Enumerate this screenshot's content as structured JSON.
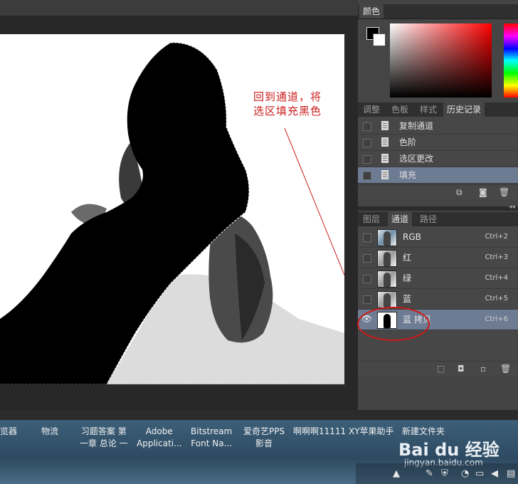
{
  "annotation": {
    "text": "回到通道，将\n选区填充黑色"
  },
  "panels": {
    "color": {
      "tab": "颜色"
    },
    "history_tabs": [
      {
        "label": "调整"
      },
      {
        "label": "色板"
      },
      {
        "label": "样式"
      },
      {
        "label": "历史记录",
        "active": true
      }
    ],
    "history_items": [
      {
        "label": "复制通道"
      },
      {
        "label": "色阶"
      },
      {
        "label": "选区更改"
      },
      {
        "label": "填充",
        "active": true
      }
    ],
    "layers_tabs": [
      {
        "label": "图层"
      },
      {
        "label": "通道",
        "active": true
      },
      {
        "label": "路径"
      }
    ],
    "channels": [
      {
        "name": "RGB",
        "shortcut": "Ctrl+2"
      },
      {
        "name": "红",
        "shortcut": "Ctrl+3"
      },
      {
        "name": "绿",
        "shortcut": "Ctrl+4"
      },
      {
        "name": "蓝",
        "shortcut": "Ctrl+5"
      },
      {
        "name": "蓝 拷贝",
        "shortcut": "Ctrl+6",
        "active": true,
        "visible": true
      }
    ]
  },
  "taskbar": {
    "items": [
      {
        "label": "览器"
      },
      {
        "label": "物流"
      },
      {
        "label": "习题答案 第\n一章 总论 一"
      },
      {
        "label": "Adobe\nApplicati..."
      },
      {
        "label": "Bitstream\nFont Na..."
      },
      {
        "label": "爱奇艺PPS\n影音"
      },
      {
        "label": "啊啊啊11111"
      },
      {
        "label": "XY苹果助手"
      },
      {
        "label": "新建文件夹"
      }
    ]
  },
  "watermark": {
    "text": "Bai du 经验",
    "sub": "jingyan.baidu.com"
  },
  "colors": {
    "annotation": "#cc2020",
    "active_row": "#6d7b93",
    "panel_bg": "#474747"
  }
}
